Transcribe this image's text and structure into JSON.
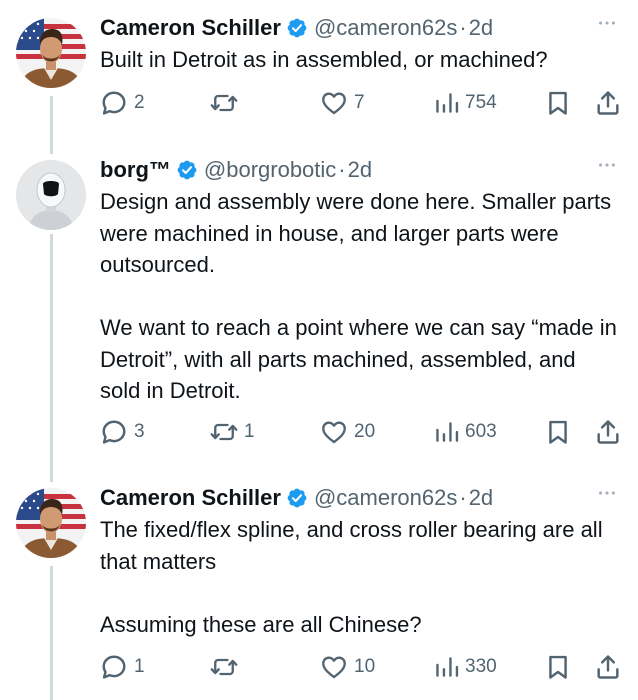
{
  "tweets": [
    {
      "author": "Cameron Schiller",
      "handle": "@cameron62s",
      "separator": "·",
      "time": "2d",
      "paragraphs": [
        "Built in Detroit as in assembled, or machined?"
      ],
      "replies": "2",
      "reposts": "",
      "likes": "7",
      "views": "754"
    },
    {
      "author": "borg™",
      "handle": "@borgrobotic",
      "separator": "·",
      "time": "2d",
      "paragraphs": [
        "Design and assembly were done here. Smaller parts were machined in house, and larger parts were outsourced.",
        "We want to reach a point where we can say “made in Detroit”, with all parts machined, assembled, and sold in Detroit."
      ],
      "replies": "3",
      "reposts": "1",
      "likes": "20",
      "views": "603"
    },
    {
      "author": "Cameron Schiller",
      "handle": "@cameron62s",
      "separator": "·",
      "time": "2d",
      "paragraphs": [
        "The fixed/flex spline, and cross roller bearing are all that matters",
        "Assuming these are all Chinese?"
      ],
      "replies": "1",
      "reposts": "",
      "likes": "10",
      "views": "330"
    }
  ],
  "colors": {
    "text": "#0f1419",
    "secondary": "#536471",
    "verified": "#1d9bf0",
    "thread_line": "#cfd9de"
  },
  "icons": [
    "verified-badge-icon",
    "more-icon",
    "reply-icon",
    "repost-icon",
    "like-icon",
    "views-icon",
    "bookmark-icon",
    "share-icon"
  ]
}
